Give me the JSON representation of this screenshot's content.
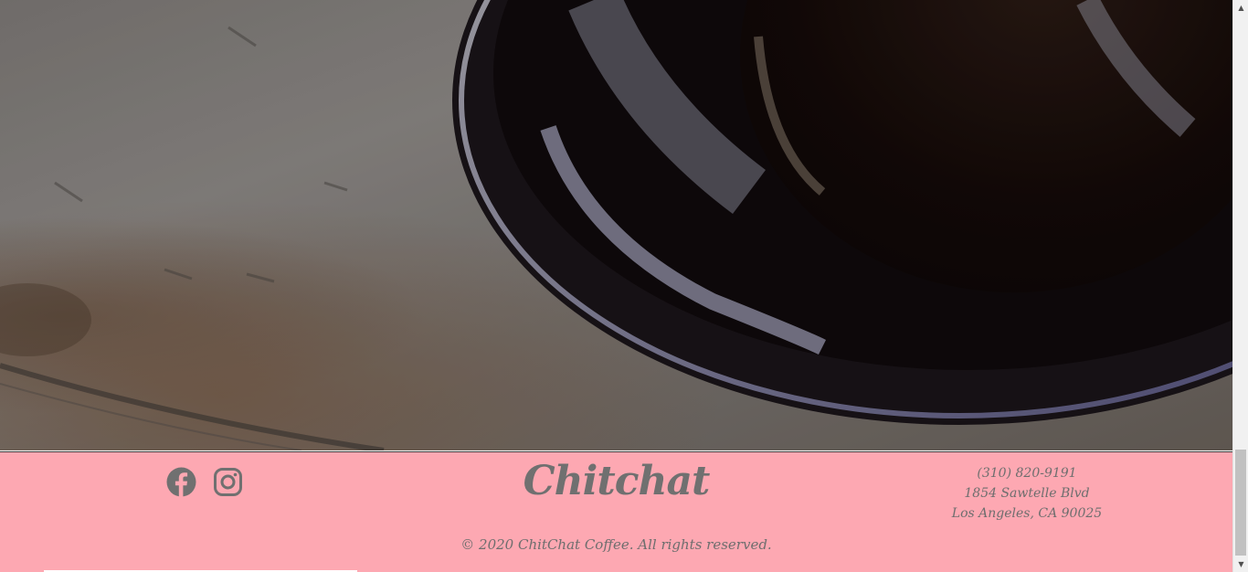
{
  "hero": {
    "image": "coffee-cup-on-wooden-table"
  },
  "footer": {
    "background_color": "#fda8b2",
    "text_color": "#6e6e6e",
    "brand": "Chitchat",
    "social": [
      {
        "icon": "facebook-icon"
      },
      {
        "icon": "instagram-icon"
      }
    ],
    "contact": {
      "phone": "(310) 820-9191",
      "street": "1854 Sawtelle Blvd",
      "city": "Los Angeles, CA 90025"
    },
    "copyright": "© 2020 ChitChat Coffee. All rights reserved."
  },
  "scrollbar": {
    "up_arrow": "▲",
    "down_arrow": "▼"
  }
}
